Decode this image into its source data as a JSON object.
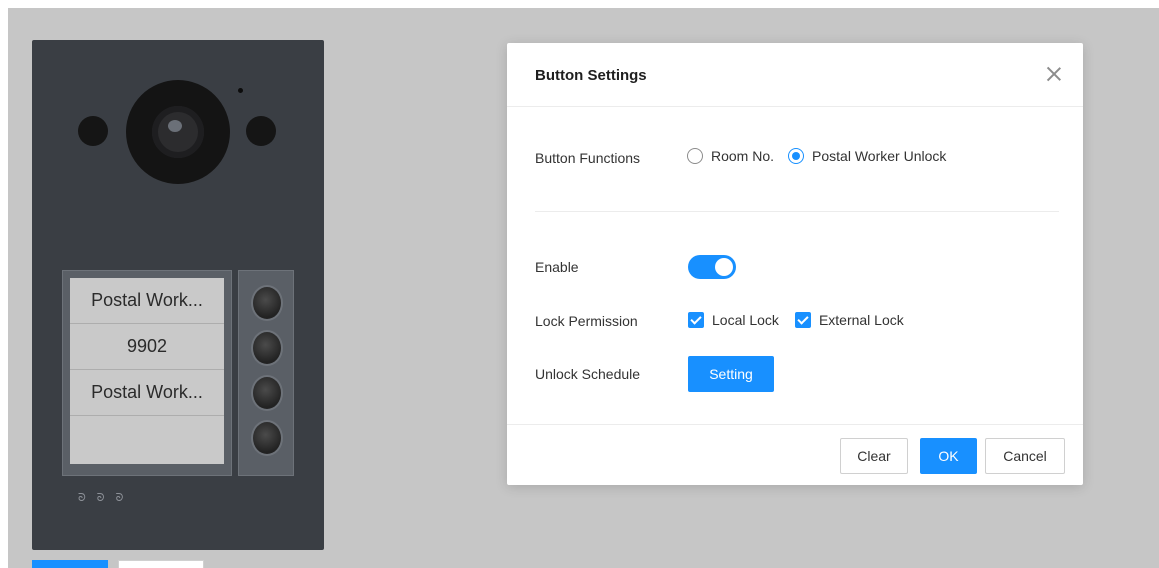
{
  "panel": {
    "labels": [
      "Postal Work...",
      "9902",
      "Postal Work...",
      ""
    ],
    "indicator_icons": "ᘐ ᘐ ᘐ"
  },
  "dialog": {
    "title": "Button Settings",
    "fields": {
      "button_functions": {
        "label": "Button Functions",
        "options": [
          "Room No.",
          "Postal Worker Unlock"
        ],
        "selected": "Postal Worker Unlock"
      },
      "enable": {
        "label": "Enable",
        "value": true
      },
      "lock_permission": {
        "label": "Lock Permission",
        "options": [
          {
            "label": "Local Lock",
            "checked": true
          },
          {
            "label": "External Lock",
            "checked": true
          }
        ]
      },
      "unlock_schedule": {
        "label": "Unlock Schedule",
        "button": "Setting"
      }
    },
    "footer": {
      "clear": "Clear",
      "ok": "OK",
      "cancel": "Cancel"
    }
  },
  "colors": {
    "accent": "#1890ff",
    "overlay": "#c6c6c6",
    "panel": "#3a3e44"
  },
  "icons": [
    "close-icon",
    "checkmark-icon",
    "radio-icon"
  ]
}
